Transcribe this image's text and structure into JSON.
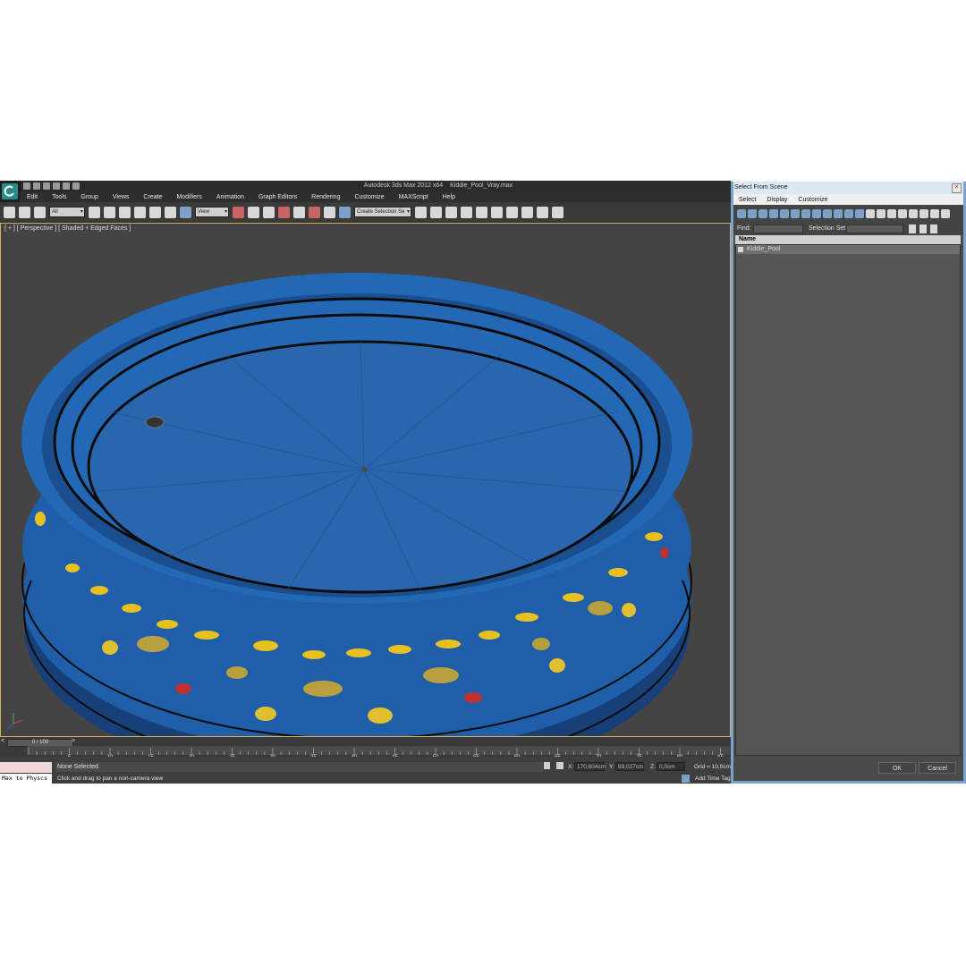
{
  "window": {
    "title": "Autodesk 3ds Max  2012 x64",
    "file": "Kiddie_Pool_Vray.max"
  },
  "menubar": [
    "Edit",
    "Tools",
    "Group",
    "Views",
    "Create",
    "Modifiers",
    "Animation",
    "Graph Editors",
    "Rendering",
    "Customize",
    "MAXScript",
    "Help"
  ],
  "toolbar": {
    "selection_filter": "All",
    "reference_coord": "View",
    "named_selection": "Create Selection Se"
  },
  "viewport": {
    "label": "[ + ] [ Perspective ] [ Shaded + Edged Faces ]"
  },
  "timeline": {
    "frame": "0 / 100",
    "ticks": [
      "0",
      "5",
      "10",
      "15",
      "20",
      "25",
      "30",
      "35",
      "40",
      "45",
      "50",
      "55",
      "60",
      "65",
      "70",
      "75",
      "80",
      "85"
    ]
  },
  "status": {
    "maxscript": "Max to Physcs",
    "selection": "None Selected",
    "prompt": "Click and drag to pan a non-camera view",
    "x_label": "X:",
    "x_value": "170,604cm",
    "y_label": "Y:",
    "y_value": "89,027cm",
    "z_label": "Z:",
    "z_value": "0,0cm",
    "grid": "Grid = 10,0cm",
    "add_time_tag": "Add Time Tag"
  },
  "dialog": {
    "title": "Select From Scene",
    "menu": [
      "Select",
      "Display",
      "Customize"
    ],
    "find_label": "Find:",
    "selection_set_label": "Selection Set:",
    "column_header": "Name",
    "rows": [
      "Kiddie_Pool"
    ],
    "ok": "OK",
    "cancel": "Cancel"
  },
  "colors": {
    "pool_blue": "#1f5ea8",
    "pool_floor": "#2a66ae",
    "viewport_bg": "#444444",
    "dialog_frame": "#7aa4cc",
    "active_viewport_border": "#d8b25a"
  }
}
